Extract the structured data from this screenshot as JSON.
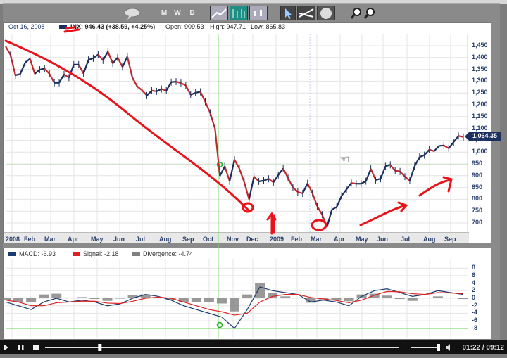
{
  "toolbar": {
    "period_buttons": [
      "M",
      "W",
      "D"
    ],
    "icons": [
      "chat-bubble-icon",
      "line-chart-icon",
      "ohlc-chart-icon",
      "candlestick-chart-icon",
      "pointer-icon",
      "drawing-tool-icon",
      "indicator-icon",
      "zoom-in-icon",
      "zoom-out-icon"
    ]
  },
  "info": {
    "date": "Oct 16, 2008",
    "symbol_quote": "INX: 946.43 (+38.59, +4.25%)",
    "open": "Open: 909.53",
    "high": "High: 947.71",
    "low": "Low: 865.83"
  },
  "last_price_tag": "1,064.35",
  "colors": {
    "price_up": "#1b2f5e",
    "price_down": "#c0282d",
    "macd": "#1b3a6e",
    "signal": "#e02020",
    "divergence": "#808080",
    "annotation": "#e8131b",
    "crosshair": "#7fdc6f"
  },
  "macd_legend": {
    "macd": "MACD: -6.93",
    "signal": "Signal: -2.18",
    "divergence": "Divergence: -4.74"
  },
  "player": {
    "time": "01:22 / 09:12",
    "progress": 0.15,
    "volume": 0.8
  },
  "chart_data": [
    {
      "type": "candlestick",
      "title": "",
      "ylim": [
        680,
        1480
      ],
      "y_ticks": [
        "1,450",
        "1,400",
        "1,350",
        "1,300",
        "1,250",
        "1,200",
        "1,150",
        "1,100",
        "1,050",
        "1,000",
        "950",
        "900",
        "850",
        "800",
        "750",
        "700"
      ],
      "x_ticks": [
        "2008",
        "Feb",
        "Mar",
        "Apr",
        "May",
        "Jun",
        "Jul",
        "Aug",
        "Sep",
        "Oct",
        "Nov",
        "Dec",
        "2009",
        "Feb",
        "Mar",
        "Apr",
        "May",
        "Jun",
        "Jul",
        "Aug",
        "Sep"
      ],
      "weekly_close": [
        1447,
        1411,
        1325,
        1330,
        1378,
        1395,
        1331,
        1349,
        1353,
        1331,
        1293,
        1293,
        1329,
        1315,
        1370,
        1370,
        1332,
        1390,
        1397,
        1413,
        1388,
        1425,
        1375,
        1400,
        1360,
        1404,
        1317,
        1278,
        1262,
        1239,
        1260,
        1257,
        1267,
        1260,
        1296,
        1298,
        1292,
        1282,
        1242,
        1251,
        1255,
        1213,
        1166,
        1099,
        899,
        940,
        877,
        968,
        930,
        873,
        800,
        896,
        876,
        879,
        887,
        872,
        903,
        931,
        890,
        850,
        831,
        825,
        868,
        826,
        770,
        735,
        683,
        756,
        768,
        815,
        842,
        869,
        866,
        866,
        877,
        929,
        882,
        887,
        940,
        946,
        921,
        918,
        896,
        879,
        940,
        979,
        987,
        1010,
        1004,
        1026,
        1028,
        1016,
        1042,
        1068,
        1064
      ],
      "crosshair": {
        "date": "Oct 16, 2008",
        "value": 946.43
      }
    },
    {
      "type": "line",
      "title": "",
      "ylim": [
        -9,
        9
      ],
      "y_ticks": [
        "8",
        "6",
        "4",
        "2",
        "0",
        "-2",
        "-4",
        "-6",
        "-8"
      ],
      "series": [
        {
          "name": "MACD",
          "values": [
            -1,
            -2,
            -3,
            -1,
            0,
            -1,
            -0.5,
            -1,
            -2,
            -1.5,
            0,
            1,
            0.5,
            -0.5,
            -2,
            -3,
            -4,
            -5,
            -8,
            -3,
            3,
            2,
            1.5,
            1,
            -1,
            -0.5,
            -1,
            -2,
            0.5,
            2,
            2.5,
            1.5,
            0.5,
            1,
            2,
            1.5,
            1
          ]
        },
        {
          "name": "Signal",
          "values": [
            -0.5,
            -1,
            -2,
            -2,
            -1.2,
            -1,
            -0.8,
            -0.8,
            -1.3,
            -1.4,
            -0.8,
            0,
            0.3,
            0,
            -1,
            -2,
            -3,
            -3.6,
            -4.5,
            -4,
            -1,
            0.5,
            1,
            1,
            0.2,
            -0.2,
            -0.6,
            -1.2,
            -0.5,
            0.8,
            1.8,
            1.7,
            1.2,
            1,
            1.5,
            1.4,
            1.2
          ]
        }
      ]
    }
  ]
}
